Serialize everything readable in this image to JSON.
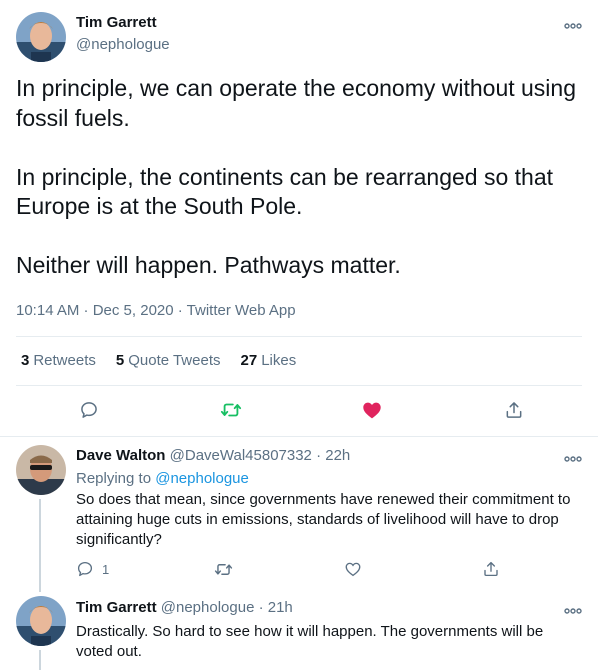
{
  "main_tweet": {
    "author_name": "Tim Garrett",
    "author_handle": "@nephologue",
    "paragraphs": [
      "In principle, we can operate the economy without using fossil fuels.",
      "In principle, the continents can be rearranged so that Europe is at the South Pole.",
      "Neither will happen. Pathways matter."
    ],
    "timestamp": "10:14 AM · Dec 5, 2020 · Twitter Web App",
    "stats": {
      "retweets_count": "3",
      "retweets_label": "Retweets",
      "quotes_count": "5",
      "quotes_label": "Quote Tweets",
      "likes_count": "27",
      "likes_label": "Likes"
    },
    "liked": true,
    "colors": {
      "like": "#e0245e",
      "retweet": "#17bf63",
      "icon": "#5b7083"
    }
  },
  "replies": [
    {
      "author_name": "Dave Walton",
      "author_handle": "@DaveWal45807332",
      "time": "· 22h",
      "replying_label": "Replying to",
      "replying_to": "@nephologue",
      "text": "So does that mean, since governments have renewed their commitment to attaining huge cuts in emissions, standards of livelihood will have to drop significantly?",
      "reply_count": "1"
    },
    {
      "author_name": "Tim Garrett",
      "author_handle": "@nephologue",
      "time": "· 21h",
      "text": "Drastically. So hard to see how it will happen. The governments will be voted out."
    }
  ]
}
